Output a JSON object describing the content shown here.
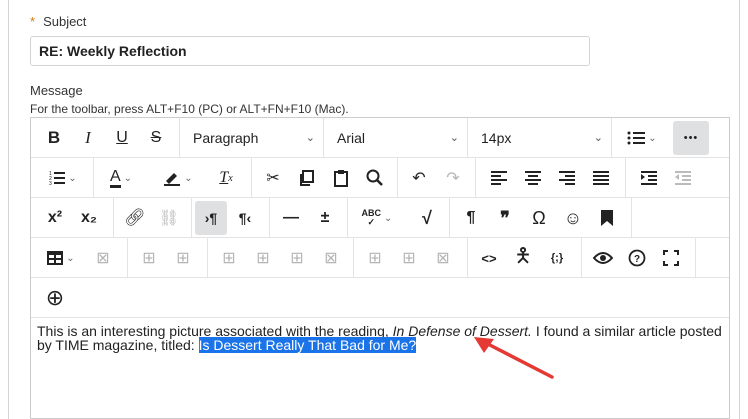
{
  "subject": {
    "required_mark": "*",
    "label": "Subject",
    "value": "RE: Weekly Reflection"
  },
  "message": {
    "label": "Message",
    "toolbar_hint": "For the toolbar, press ALT+F10 (PC) or ALT+FN+F10 (Mac)."
  },
  "toolbar": {
    "bold": "B",
    "italic": "I",
    "underline": "U",
    "strikethrough": "S",
    "block_format": "Paragraph",
    "font_family": "Arial",
    "font_size": "14px",
    "superscript": "x²",
    "subscript": "x₂",
    "pilcrow": "¶",
    "quote": "❞",
    "omega": "Ω",
    "emoji": "☺",
    "code": "<>",
    "more": "•••",
    "add": "⊕"
  },
  "content": {
    "text_1": "This is an interesting picture associated with the reading, ",
    "title_italic": "In Defense of Dessert.",
    "text_2": "  I found a similar article posted by TIME magazine, titled: ",
    "highlighted": "Is Dessert Really That Bad for Me?"
  },
  "colors": {
    "highlight": "#1a73e8",
    "arrow": "#e53935",
    "required": "#e07a10"
  }
}
